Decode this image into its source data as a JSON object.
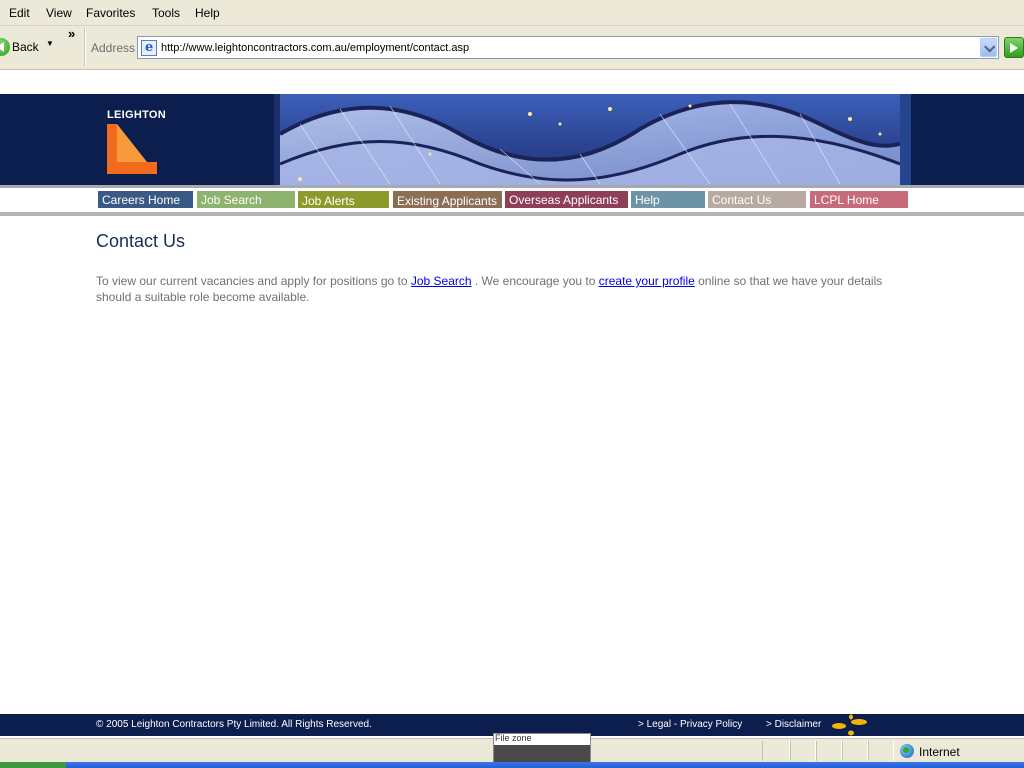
{
  "browser": {
    "menu": [
      "Edit",
      "View",
      "Favorites",
      "Tools",
      "Help"
    ],
    "back_label": "Back",
    "address_label": "Address",
    "url": "http://www.leightoncontractors.com.au/employment/contact.asp",
    "status_zone": "Internet",
    "tooltip": "File zone"
  },
  "header": {
    "logo_text": "LEIGHTON"
  },
  "nav": [
    {
      "label": "Careers Home",
      "color": "#3a5a86"
    },
    {
      "label": "Job Search",
      "color": "#8db36e"
    },
    {
      "label": "Job Alerts",
      "color": "#8c9a2c"
    },
    {
      "label": "Existing Applicants",
      "color": "#8a6f55"
    },
    {
      "label": "Overseas Applicants",
      "color": "#8f3e57"
    },
    {
      "label": "Help",
      "color": "#6d94a6"
    },
    {
      "label": "Contact Us",
      "color": "#b6aaa2"
    },
    {
      "label": "LCPL Home",
      "color": "#c66b7a"
    }
  ],
  "page": {
    "title": "Contact Us",
    "intro_1": "To view our current vacancies and apply for positions go to ",
    "link_job_search": "Job Search",
    "intro_2": " . We encourage you to ",
    "link_profile": "create your profile",
    "intro_3": " online so that we have your details should a suitable role become available."
  },
  "footer": {
    "copyright": "© 2005 Leighton Contractors Pty Limited. All Rights Reserved.",
    "legal": "> Legal - Privacy Policy",
    "disclaimer": "> Disclaimer"
  }
}
